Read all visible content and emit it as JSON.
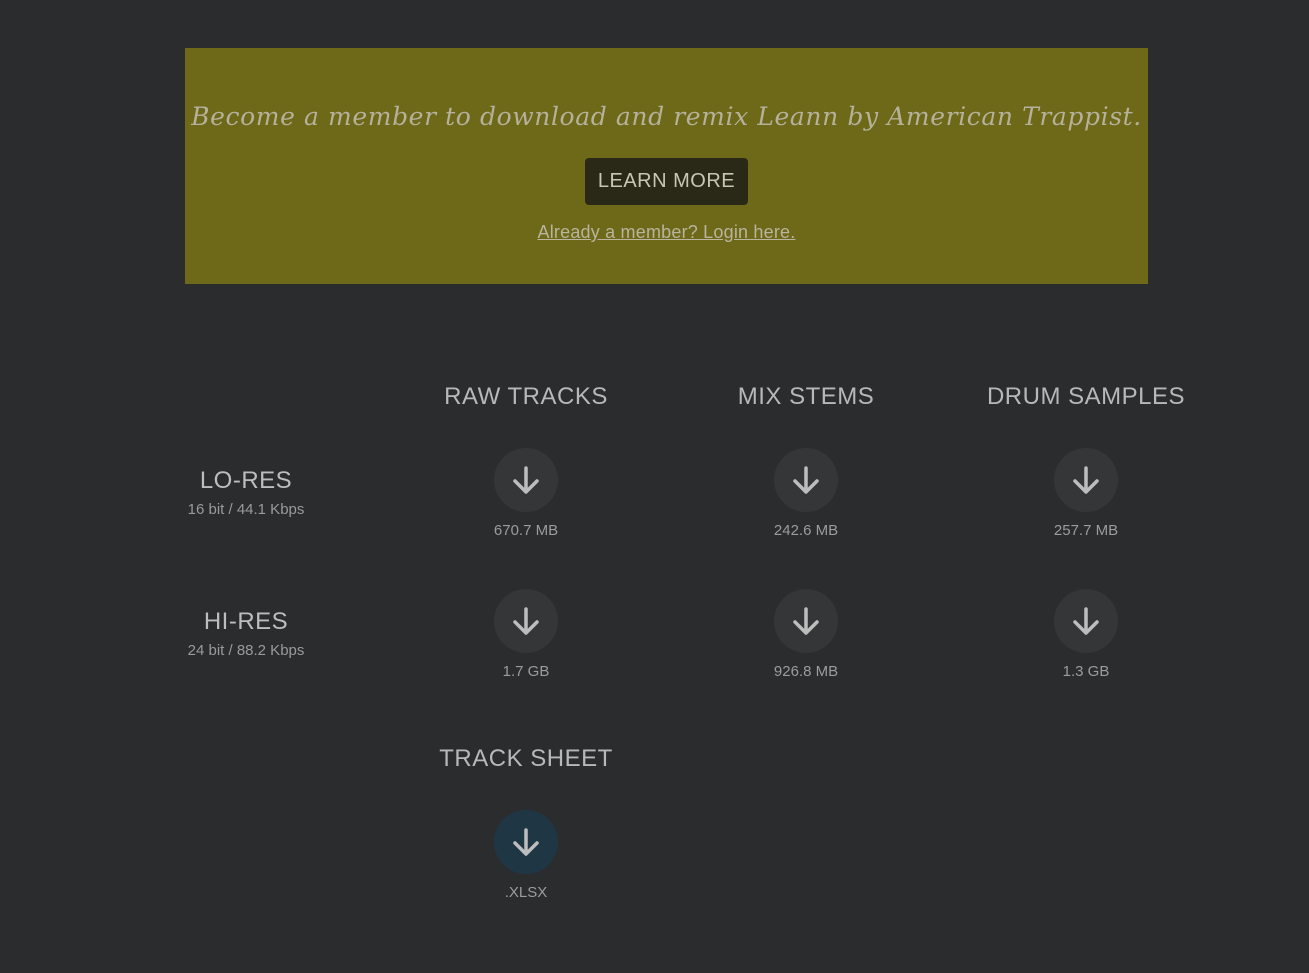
{
  "banner": {
    "message": "Become a member to download and remix Leann by American Trappist.",
    "learn_more_label": "LEARN MORE",
    "login_link": "Already a member? Login here."
  },
  "columns": [
    "RAW TRACKS",
    "MIX STEMS",
    "DRUM SAMPLES"
  ],
  "rows": [
    {
      "title": "LO-RES",
      "subtitle": "16 bit / 44.1 Kbps",
      "sizes": [
        "670.7 MB",
        "242.6 MB",
        "257.7 MB"
      ]
    },
    {
      "title": "HI-RES",
      "subtitle": "24 bit / 88.2 Kbps",
      "sizes": [
        "1.7 GB",
        "926.8 MB",
        "1.3 GB"
      ]
    }
  ],
  "track_sheet": {
    "title": "TRACK SHEET",
    "format": ".XLSX"
  },
  "colors": {
    "background": "#2b2c2e",
    "banner": "#6e6819",
    "button_circle": "#353638",
    "track_sheet_circle": "#1f3644"
  },
  "icons": {
    "download": "arrow-down-icon"
  }
}
